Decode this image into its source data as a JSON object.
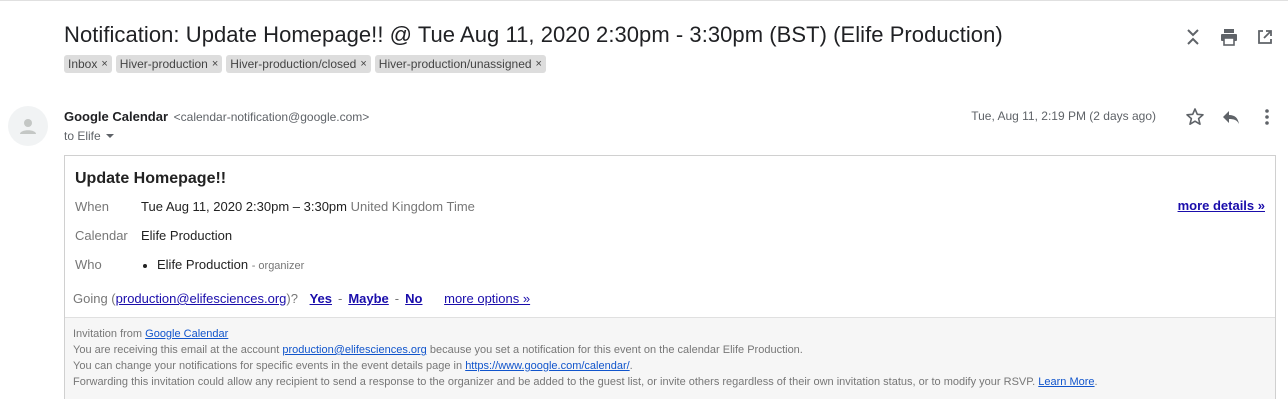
{
  "subject": "Notification: Update Homepage!! @ Tue Aug 11, 2020 2:30pm - 3:30pm (BST) (Elife Production)",
  "labels": [
    "Inbox",
    "Hiver-production",
    "Hiver-production/closed",
    "Hiver-production/unassigned"
  ],
  "label_close": "×",
  "top_icons": [
    "collapse-icon",
    "print-icon",
    "open-in-new-window-icon"
  ],
  "sender": {
    "name": "Google Calendar",
    "email": "<calendar-notification@google.com>",
    "to": "to Elife",
    "date": "Tue, Aug 11, 2:19 PM (2 days ago)"
  },
  "message_icons": [
    "star-icon",
    "reply-icon",
    "more-vert-icon"
  ],
  "event": {
    "title": "Update Homepage!!",
    "when_label": "When",
    "when_value": "Tue Aug 11, 2020 2:30pm – 3:30pm",
    "when_tz": "United Kingdom Time",
    "more_details": "more details »",
    "calendar_label": "Calendar",
    "calendar_value": "Elife Production",
    "who_label": "Who",
    "who_name": "Elife Production",
    "who_role": "- organizer"
  },
  "rsvp": {
    "going_prefix": "Going (",
    "email": "production@elifesciences.org",
    "going_suffix": ")?",
    "yes": "Yes",
    "maybe": "Maybe",
    "no": "No",
    "dash": "-",
    "more_options": "more options »"
  },
  "footer": {
    "line1_prefix": "Invitation from ",
    "line1_link": "Google Calendar",
    "line2_prefix": "You are receiving this email at the account ",
    "line2_link": "production@elifesciences.org",
    "line2_suffix": " because you set a notification for this event on the calendar Elife Production.",
    "line3_prefix": "You can change your notifications for specific events in the event details page in ",
    "line3_link": "https://www.google.com/calendar/",
    "line3_suffix": ".",
    "line4_prefix": "Forwarding this invitation could allow any recipient to send a response to the organizer and be added to the guest list, or invite others regardless of their own invitation status, or to modify your RSVP. ",
    "line4_link": "Learn More",
    "line4_suffix": "."
  }
}
